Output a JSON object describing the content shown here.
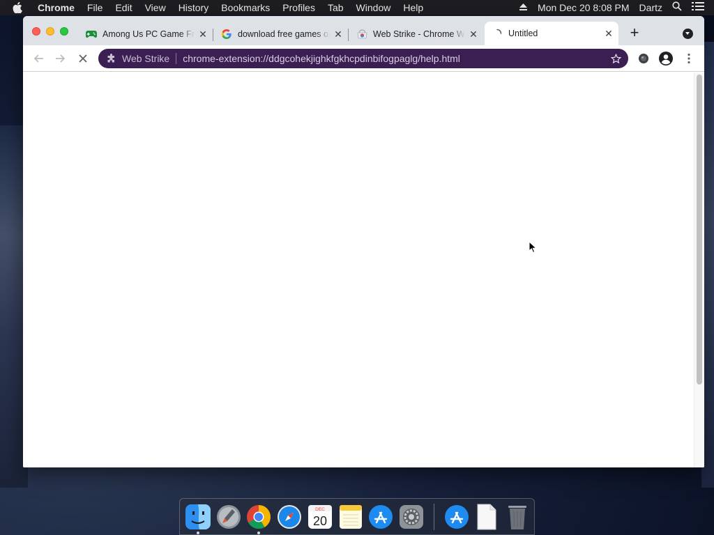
{
  "menubar": {
    "app_name": "Chrome",
    "items": [
      "File",
      "Edit",
      "View",
      "History",
      "Bookmarks",
      "Profiles",
      "Tab",
      "Window",
      "Help"
    ],
    "clock": "Mon Dec 20  8:08 PM",
    "user": "Dartz"
  },
  "tabs": [
    {
      "title": "Among Us PC Game Free",
      "icon": "gamepad-icon",
      "active": false
    },
    {
      "title": "download free games on",
      "icon": "google-icon",
      "active": false
    },
    {
      "title": "Web Strike - Chrome Web",
      "icon": "webstore-icon",
      "active": false
    },
    {
      "title": "Untitled",
      "icon": "loading-spinner-icon",
      "active": true
    }
  ],
  "omnibox": {
    "chip": "Web Strike",
    "url": "chrome-extension://ddgcohekjighkfgkhcpdinbifogpaglg/help.html"
  },
  "colors": {
    "omnibox_bg": "#3b1f52",
    "tabstrip_bg": "#dee1e6"
  },
  "dock": [
    "finder",
    "launchpad",
    "chrome",
    "safari",
    "calendar",
    "notes",
    "app-store",
    "system-preferences",
    "app-store-downloads",
    "document",
    "trash"
  ],
  "calendar": {
    "month": "DEC",
    "day": "20"
  }
}
